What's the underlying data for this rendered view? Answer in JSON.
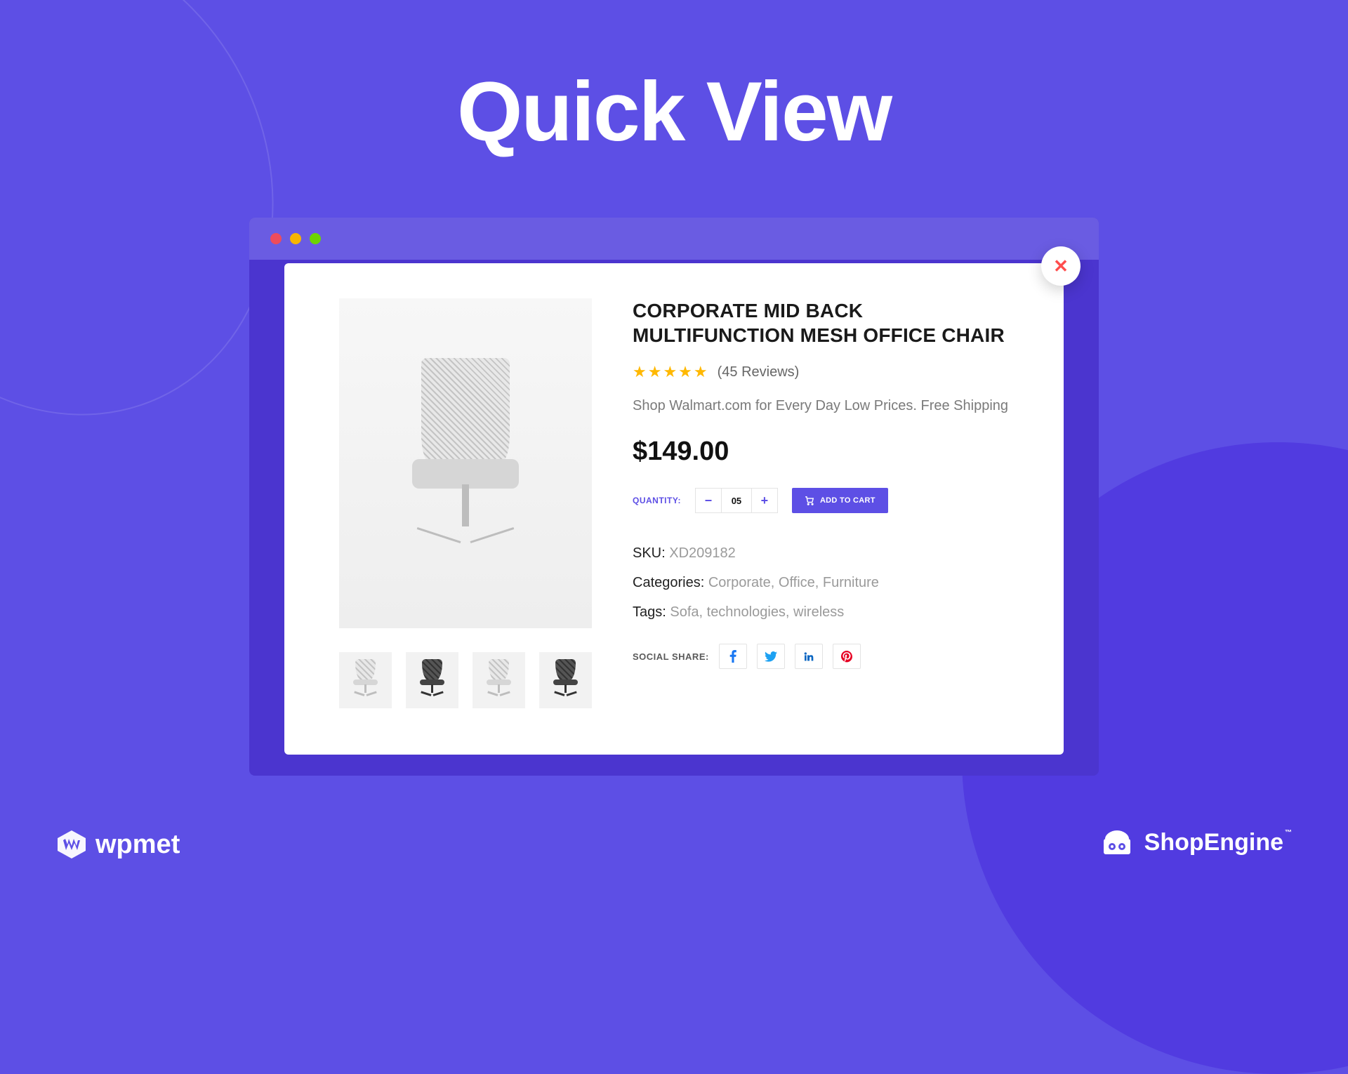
{
  "page": {
    "title": "Quick View"
  },
  "traffic_lights": {
    "red": "#ED4C5C",
    "yellow": "#F7B500",
    "green": "#6DD400"
  },
  "product": {
    "title": "CORPORATE MID BACK MULTIFUNCTION MESH OFFICE CHAIR",
    "rating_stars": 5,
    "reviews_text": "(45 Reviews)",
    "description": "Shop Walmart.com for Every Day Low Prices. Free Shipping",
    "price": "$149.00",
    "quantity_label": "QUANTITY:",
    "quantity_value": "05",
    "add_to_cart_label": "ADD TO CART",
    "sku": {
      "label": "SKU:",
      "value": "XD209182"
    },
    "categories": {
      "label": "Categories:",
      "value": "Corporate, Office, Furniture"
    },
    "tags": {
      "label": "Tags:",
      "value": "Sofa, technologies, wireless"
    },
    "share_label": "SOCIAL SHARE:",
    "thumbs": [
      "light",
      "dark",
      "light",
      "dark"
    ]
  },
  "social": {
    "facebook": "facebook-icon",
    "twitter": "twitter-icon",
    "linkedin": "linkedin-icon",
    "pinterest": "pinterest-icon"
  },
  "brands": {
    "wpmet": "wpmet",
    "shopengine": "ShopEngine"
  },
  "colors": {
    "accent": "#5D4FE5",
    "close": "#FF4D4D",
    "star": "#FFB800"
  }
}
